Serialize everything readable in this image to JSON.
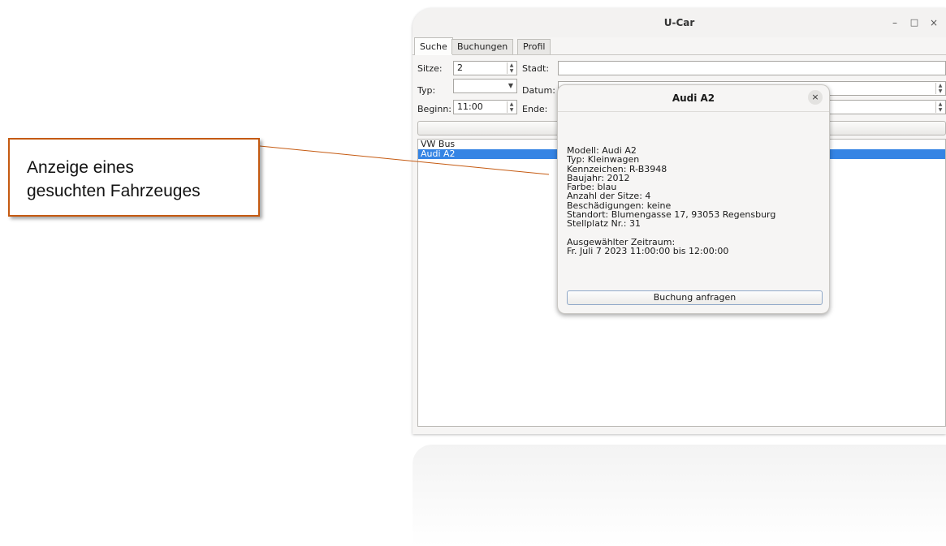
{
  "window": {
    "title": "U-Car",
    "controls": {
      "minimize": "–",
      "maximize": "□",
      "close": "×"
    }
  },
  "tabs": [
    {
      "label": "Suche",
      "active": true
    },
    {
      "label": "Buchungen",
      "active": false
    },
    {
      "label": "Profil",
      "active": false
    }
  ],
  "search": {
    "seats_label": "Sitze:",
    "seats_value": "2",
    "city_label": "Stadt:",
    "city_value": "",
    "type_label": "Typ:",
    "type_value": "",
    "date_label": "Datum:",
    "start_label": "Beginn:",
    "start_value": "11:00",
    "end_label": "Ende:"
  },
  "results": [
    {
      "label": "VW Bus",
      "selected": false
    },
    {
      "label": "Audi A2",
      "selected": true
    }
  ],
  "dialog": {
    "title": "Audi A2",
    "close": "×",
    "lines": [
      "Modell: Audi A2",
      "Typ: Kleinwagen",
      "Kennzeichen: R-B3948",
      "Baujahr: 2012",
      "Farbe: blau",
      "Anzahl der Sitze: 4",
      "Beschädigungen: keine",
      "Standort: Blumengasse 17, 93053 Regensburg",
      "Stellplatz Nr.: 31"
    ],
    "period_label": "Ausgewählter Zeitraum:",
    "period_value": "Fr. Juli 7 2023 11:00:00 bis 12:00:00",
    "request_button": "Buchung anfragen"
  },
  "callout": {
    "line1": "Anzeige eines",
    "line2": "gesuchten Fahrzeuges",
    "border_color": "#c55a11"
  },
  "colors": {
    "selection": "#3584e4"
  }
}
